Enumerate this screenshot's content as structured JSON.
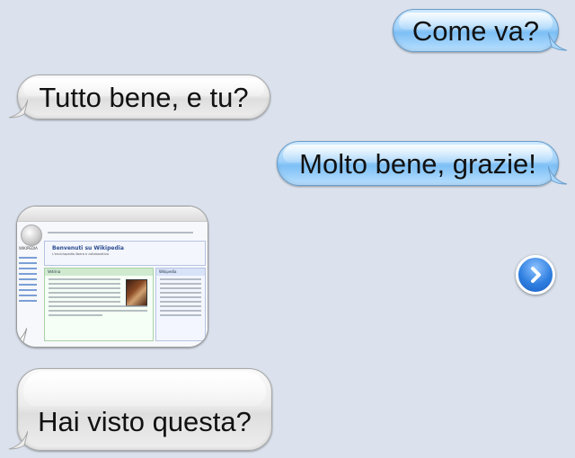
{
  "messages": [
    {
      "direction": "sent",
      "text": "Come va?"
    },
    {
      "direction": "received",
      "text": "Tutto bene, e tu?"
    },
    {
      "direction": "sent",
      "text": "Molto bene, grazie!"
    },
    {
      "direction": "received",
      "type": "image",
      "image": {
        "title": "Benvenuti su Wikipedia",
        "subtitle": "L'enciclopedia libera e collaborativa",
        "logo_text": "WIKIPEDIA",
        "left_box_title": "Vetrina",
        "right_box_title": "Wikipedia"
      }
    },
    {
      "direction": "received",
      "text": "Hai visto questa?"
    }
  ],
  "icons": {
    "disclosure": "chevron-right-icon"
  },
  "colors": {
    "background": "#dbe2ed",
    "sent_bubble": "#9fd1fa",
    "received_bubble": "#ececec",
    "disclosure": "#2f7fe0"
  }
}
